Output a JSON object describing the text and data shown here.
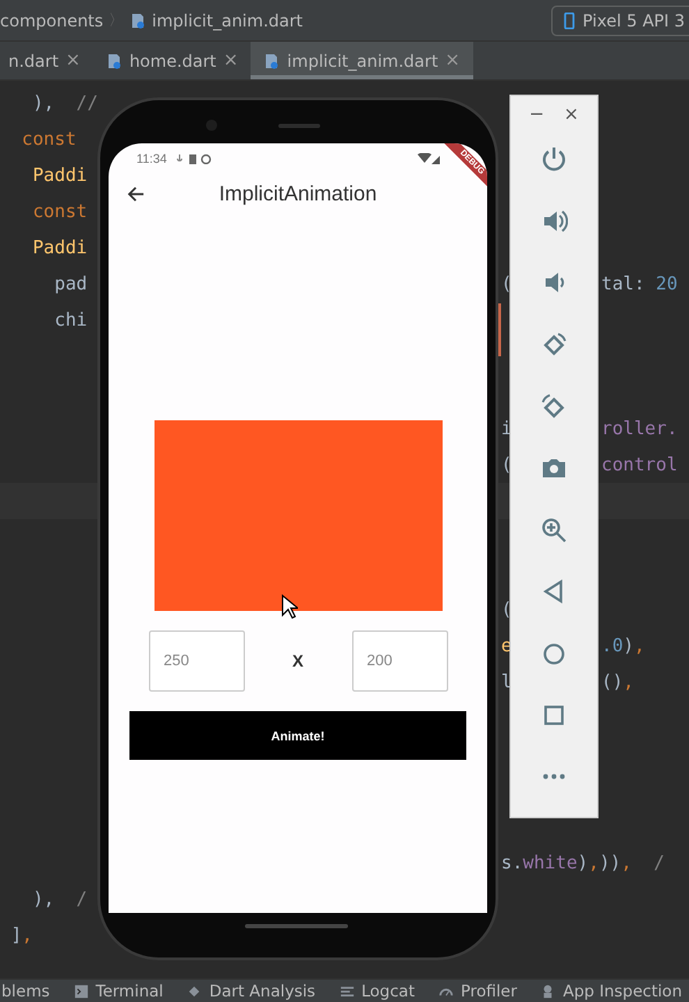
{
  "breadcrumb": {
    "items": [
      "components",
      "implicit_anim.dart"
    ],
    "separator": "〉"
  },
  "device_selector": {
    "label": "Pixel 5 API 3"
  },
  "tabs": [
    {
      "label": "n.dart",
      "close": "×",
      "selected": false
    },
    {
      "label": "home.dart",
      "close": "×",
      "selected": false
    },
    {
      "label": "implicit_anim.dart",
      "close": "×",
      "selected": true
    }
  ],
  "code_lines": [
    {
      "left": [
        {
          "text": "   ),",
          "kind": "plain"
        },
        {
          "text": "  //",
          "kind": "comment"
        }
      ]
    },
    {
      "left": [
        {
          "text": "  const",
          "kind": "keyword"
        }
      ]
    },
    {
      "left": [
        {
          "text": "   Paddi",
          "kind": "class"
        }
      ]
    },
    {
      "left": [
        {
          "text": "   const",
          "kind": "keyword"
        }
      ]
    },
    {
      "left": [
        {
          "text": "   Paddi",
          "kind": "class"
        }
      ]
    },
    {
      "left": [
        {
          "text": "     pad",
          "kind": "plain"
        }
      ],
      "gutter": [
        {
          "text": "(",
          "kind": "plain"
        }
      ],
      "tail": [
        {
          "text": "tal: ",
          "kind": "plain"
        },
        {
          "text": "20",
          "kind": "number"
        }
      ]
    },
    {
      "left": [
        {
          "text": "     chi",
          "kind": "plain"
        }
      ]
    },
    {
      "gutter": [
        {
          "text": "i",
          "kind": "plain"
        }
      ],
      "tail": [
        {
          "text": "roller.",
          "kind": "field"
        }
      ]
    },
    {
      "gutter": [
        {
          "text": "(",
          "kind": "plain"
        }
      ],
      "tail": [
        {
          "text": "control",
          "kind": "field"
        }
      ]
    },
    {
      "gutter": [
        {
          "text": "(",
          "kind": "plain"
        }
      ]
    },
    {
      "gutter": [
        {
          "text": "e",
          "kind": "class"
        }
      ],
      "tail": [
        {
          "text": ".0",
          "kind": "number"
        },
        {
          "text": ")",
          "kind": "plain"
        },
        {
          "text": ",",
          "kind": "keyword"
        }
      ]
    },
    {
      "gutter": [
        {
          "text": "l",
          "kind": "plain"
        }
      ],
      "tail": [
        {
          "text": "()",
          "kind": "plain"
        },
        {
          "text": ",",
          "kind": "keyword"
        }
      ]
    },
    {
      "gutter": [
        {
          "text": "s.",
          "kind": "plain"
        },
        {
          "text": "white",
          "kind": "field"
        },
        {
          "text": ")",
          "kind": "plain"
        },
        {
          "text": ",",
          "kind": "keyword"
        },
        {
          "text": "))",
          "kind": "plain"
        },
        {
          "text": ",",
          "kind": "keyword"
        },
        {
          "text": "  /",
          "kind": "comment"
        }
      ]
    },
    {
      "left": [
        {
          "text": "   ),",
          "kind": "plain"
        },
        {
          "text": "  /",
          "kind": "comment"
        }
      ]
    },
    {
      "left": [
        {
          "text": " ]",
          "kind": "plain"
        },
        {
          "text": ",",
          "kind": "keyword"
        }
      ]
    }
  ],
  "current_line_highlighted": true,
  "phone": {
    "status_time": "11:34",
    "debug_banner": "DEBUG",
    "app_bar": {
      "title": "ImplicitAnimation"
    },
    "width_field": {
      "value": "250"
    },
    "separator": "X",
    "height_field": {
      "value": "200"
    },
    "button": "Animate!"
  },
  "emulator_toolbar": {
    "minimize": "−",
    "close": "×",
    "tools": [
      {
        "kind": "power"
      },
      {
        "kind": "volume-up"
      },
      {
        "kind": "volume-down"
      },
      {
        "kind": "rotate-left"
      },
      {
        "kind": "rotate-right"
      },
      {
        "kind": "camera"
      },
      {
        "kind": "zoom"
      },
      {
        "kind": "back"
      },
      {
        "kind": "home"
      },
      {
        "kind": "overview"
      },
      {
        "kind": "more"
      }
    ]
  },
  "tool_windows": [
    {
      "label": "blems",
      "kind": "none"
    },
    {
      "label": "Terminal",
      "kind": "terminal"
    },
    {
      "label": "Dart Analysis",
      "kind": "dart"
    },
    {
      "label": "Logcat",
      "kind": "logcat"
    },
    {
      "label": "Profiler",
      "kind": "profiler"
    },
    {
      "label": "App Inspection",
      "kind": "inspection"
    }
  ]
}
